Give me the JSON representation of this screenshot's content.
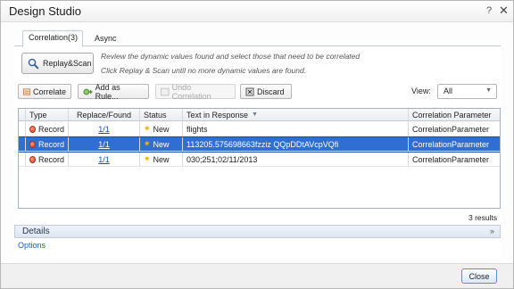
{
  "window": {
    "title": "Design Studio",
    "help_label": "?",
    "close_label": "✕"
  },
  "tabs": [
    {
      "label": "Correlation(3)",
      "active": true
    },
    {
      "label": "Async",
      "active": false
    }
  ],
  "replay_button": {
    "label": "Replay&Scan",
    "icon": "magnifier-icon"
  },
  "hints": [
    "Review the dynamic values found and select those that need to be correlated",
    "Click Replay & Scan until no more dynamic values are found."
  ],
  "toolbar": {
    "correlate_label": "Correlate",
    "add_rule_label": "Add as Rule...",
    "undo_label": "Undo Correlation",
    "discard_label": "Discard",
    "view_label": "View:",
    "view_value": "All"
  },
  "table": {
    "columns": [
      "Type",
      "Replace/Found",
      "Status",
      "Text in Response",
      "Correlation Parameter"
    ],
    "rows": [
      {
        "type": "Record",
        "found": "1/1",
        "status": "New",
        "text": "flights",
        "param": "CorrelationParameter",
        "selected": false
      },
      {
        "type": "Record",
        "found": "1/1",
        "status": "New",
        "text": "113205.575698663fzziz QQpDDtAVcpVQfi",
        "param": "CorrelationParameter",
        "selected": true
      },
      {
        "type": "Record",
        "found": "1/1",
        "status": "New",
        "text": "030;251;02/11/2013",
        "param": "CorrelationParameter",
        "selected": false
      }
    ],
    "results_count": "3 results"
  },
  "details": {
    "label": "Details",
    "chevron": "»"
  },
  "options_label": "Options",
  "close_button_label": "Close",
  "colors": {
    "selection": "#2f6fd1",
    "link": "#1a4fb0",
    "accent_star": "#f0b400"
  }
}
